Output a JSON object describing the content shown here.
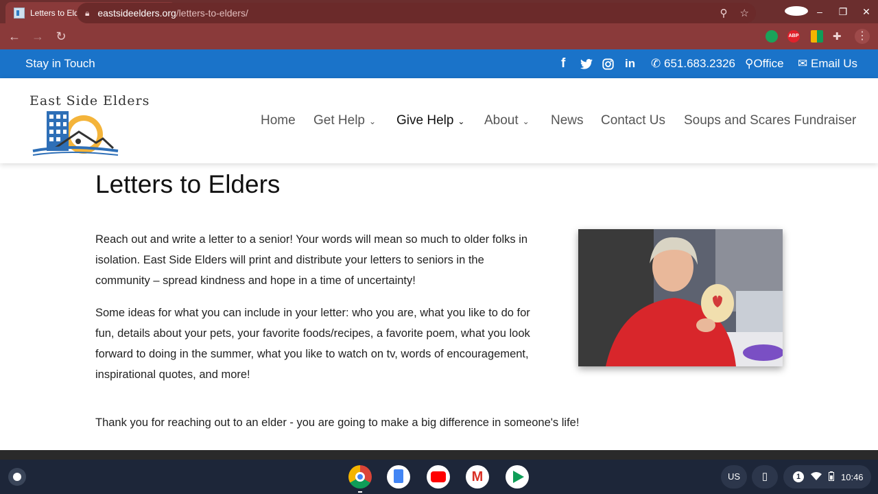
{
  "browser": {
    "tab_title": "Letters to Elders - East Side Elders",
    "tab_close": "✕",
    "new_tab": "+",
    "url_host": "eastsideelders.org",
    "url_path": "/letters-to-elders/",
    "ext_abp": "ABP"
  },
  "topbar": {
    "stay_in_touch": "Stay in Touch",
    "phone": "651.683.2326",
    "office": "Office",
    "email": "Email Us"
  },
  "logo": {
    "text": "East Side Elders"
  },
  "nav": {
    "items": [
      {
        "label": "Home"
      },
      {
        "label": "Get Help"
      },
      {
        "label": "Give Help"
      },
      {
        "label": "About"
      },
      {
        "label": "News"
      },
      {
        "label": "Contact Us"
      },
      {
        "label": "Soups and Scares Fundraiser"
      }
    ],
    "active": "Give Help"
  },
  "content": {
    "title": "Letters to Elders",
    "p1": "Reach out and write a letter to a senior!  Your words will mean so much to older folks in isolation.  East Side Elders will print and distribute your letters to seniors in the community – spread kindness and hope in a time of uncertainty!",
    "p2": "Some ideas for what you can include in your letter:  who you are, what you like to do for fun, details about your pets, your favorite foods/recipes, a favorite poem, what you look forward to doing in the summer, what you like to watch on tv, words of encouragement, inspirational quotes, and more!",
    "p3": "Thank you for reaching out to an elder - you are going to make a big difference in someone's life!"
  },
  "shelf": {
    "ime": "US",
    "notification_count": "1",
    "time": "10:46"
  },
  "colors": {
    "tabbar": "#6b2e2e",
    "toolbar": "#8a3a3a",
    "site_blue": "#1a73c9",
    "shelf": "#1d2639"
  }
}
